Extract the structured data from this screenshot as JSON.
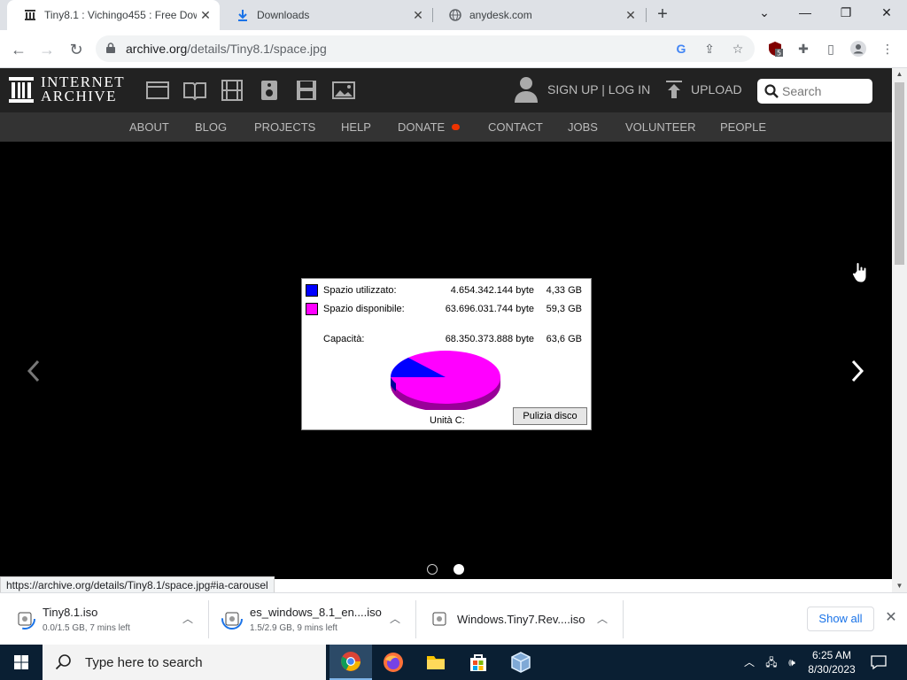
{
  "browser": {
    "tabs": [
      {
        "title": "Tiny8.1 : Vichingo455 : Free Dow",
        "active": true,
        "favicon": "archive-icon"
      },
      {
        "title": "Downloads",
        "active": false,
        "favicon": "download-icon"
      },
      {
        "title": "anydesk.com",
        "active": false,
        "favicon": "globe-icon"
      }
    ],
    "url_host": "archive.org",
    "url_path": "/details/Tiny8.1/space.jpg",
    "extension_badge": "5"
  },
  "ia": {
    "logo_line1": "INTERNET",
    "logo_line2": "ARCHIVE",
    "signup_text": "SIGN UP | LOG IN",
    "upload_text": "UPLOAD",
    "search_placeholder": "Search",
    "menu": [
      "ABOUT",
      "BLOG",
      "PROJECTS",
      "HELP",
      "DONATE",
      "CONTACT",
      "JOBS",
      "VOLUNTEER",
      "PEOPLE"
    ]
  },
  "disk_dialog": {
    "used_label": "Spazio utilizzato:",
    "used_bytes": "4.654.342.144 byte",
    "used_gb": "4,33 GB",
    "free_label": "Spazio disponibile:",
    "free_bytes": "63.696.031.744 byte",
    "free_gb": "59,3 GB",
    "capacity_label": "Capacità:",
    "capacity_bytes": "68.350.373.888 byte",
    "capacity_gb": "63,6 GB",
    "drive_label": "Unità C:",
    "cleanup_button": "Pulizia disco",
    "used_color": "#0000ff",
    "free_color": "#ff00ff"
  },
  "carousel": {
    "slide_count": 2,
    "active_slide": 2
  },
  "status_url": "https://archive.org/details/Tiny8.1/space.jpg#ia-carousel",
  "downloads": [
    {
      "name": "Tiny8.1.iso",
      "progress": "0.0/1.5 GB, 7 mins left"
    },
    {
      "name": "es_windows_8.1_en....iso",
      "progress": "1.5/2.9 GB, 9 mins left"
    },
    {
      "name": "Windows.Tiny7.Rev....iso",
      "progress": ""
    }
  ],
  "show_all": "Show all",
  "taskbar": {
    "search_placeholder": "Type here to search",
    "time": "6:25 AM",
    "date": "8/30/2023"
  }
}
